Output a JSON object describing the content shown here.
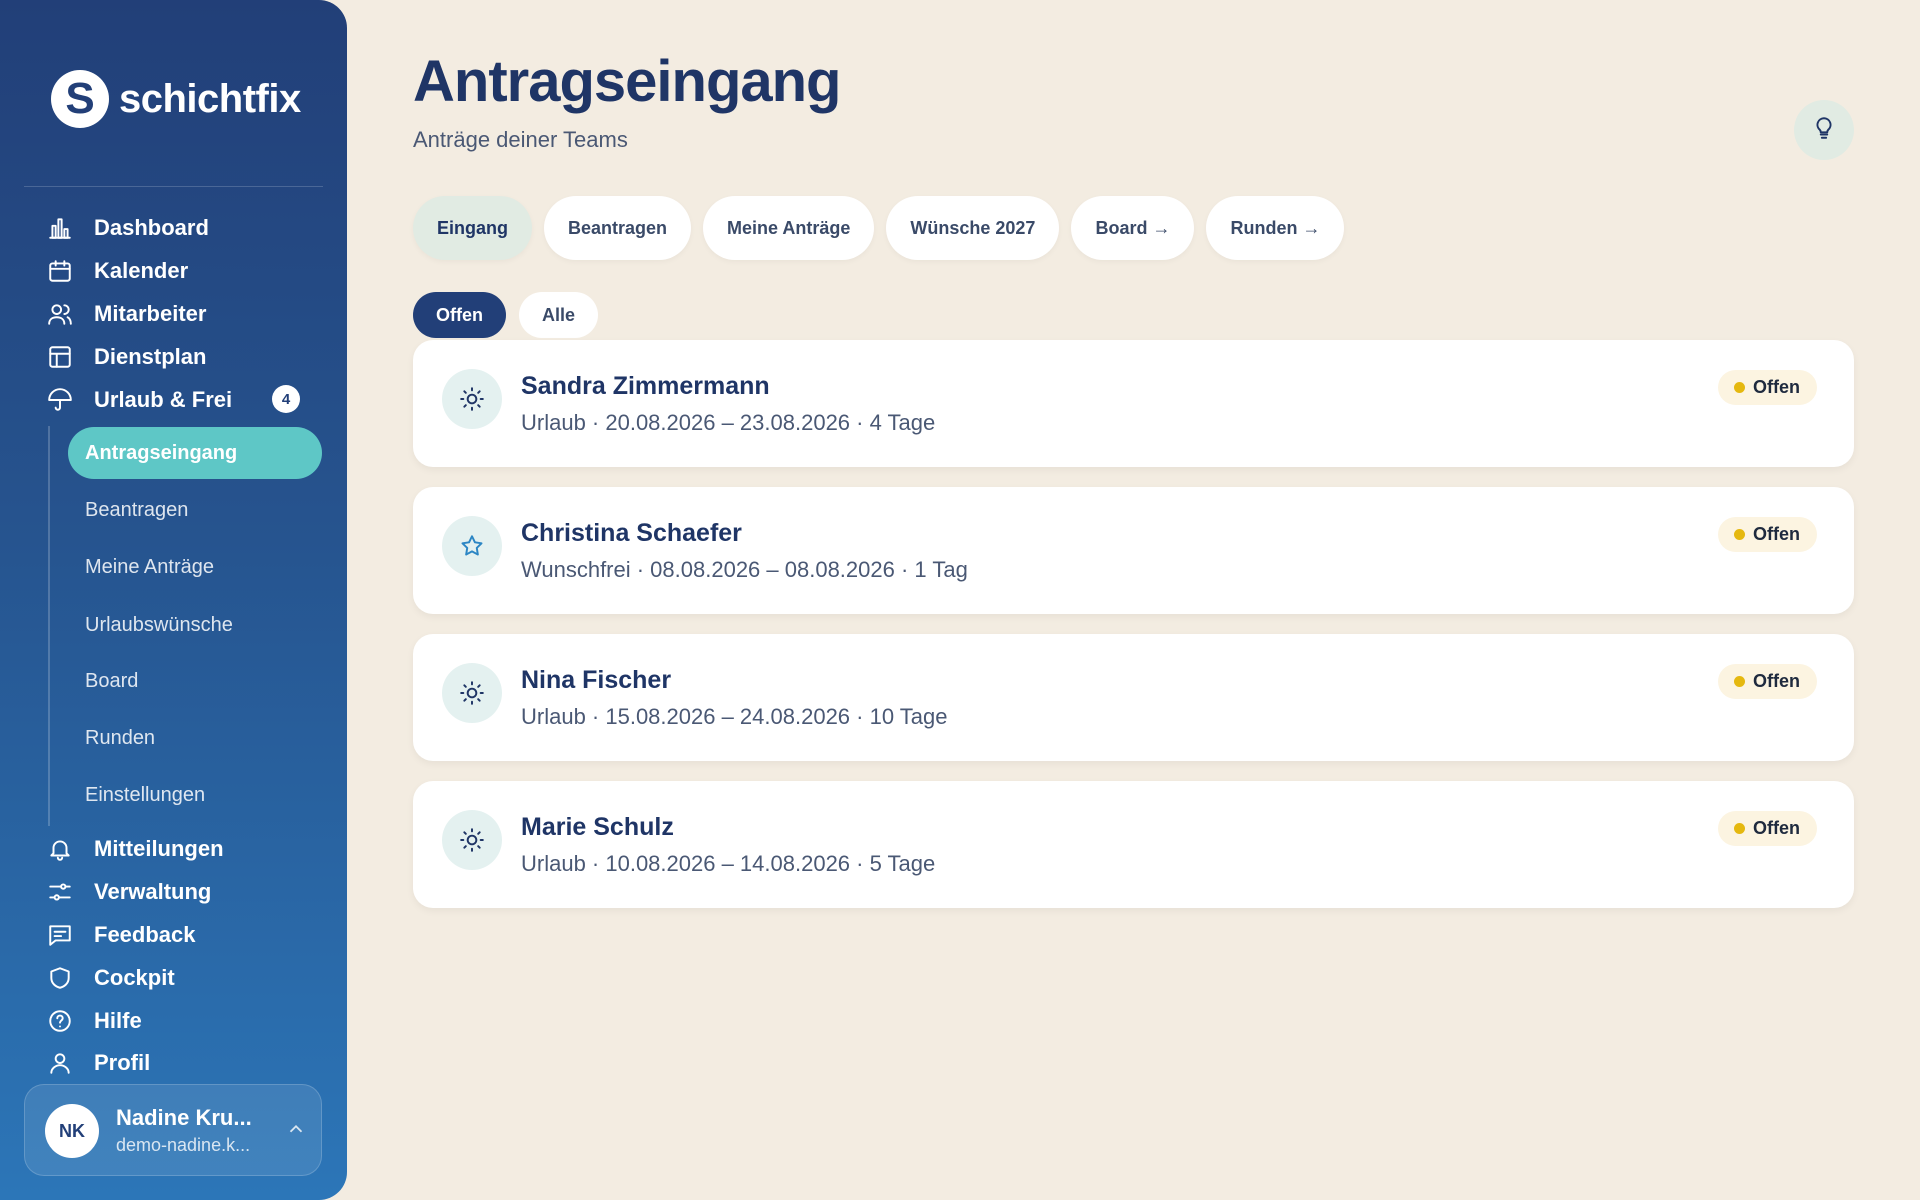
{
  "brand": {
    "name": "schichtfix",
    "mark": "S"
  },
  "sidebar": {
    "nav_top": [
      {
        "label": "Dashboard",
        "icon": "bar-chart-icon"
      },
      {
        "label": "Kalender",
        "icon": "calendar-icon"
      },
      {
        "label": "Mitarbeiter",
        "icon": "users-icon"
      },
      {
        "label": "Dienstplan",
        "icon": "layout-icon"
      },
      {
        "label": "Urlaub & Frei",
        "icon": "umbrella-icon",
        "badge": "4"
      }
    ],
    "sub_items": [
      {
        "label": "Antragseingang",
        "active": true
      },
      {
        "label": "Beantragen"
      },
      {
        "label": "Meine Anträge"
      },
      {
        "label": "Urlaubswünsche"
      },
      {
        "label": "Board"
      },
      {
        "label": "Runden"
      },
      {
        "label": "Einstellungen"
      }
    ],
    "nav_bottom": [
      {
        "label": "Mitteilungen",
        "icon": "bell-icon"
      },
      {
        "label": "Verwaltung",
        "icon": "sliders-icon"
      },
      {
        "label": "Feedback",
        "icon": "message-icon"
      },
      {
        "label": "Cockpit",
        "icon": "shield-icon"
      },
      {
        "label": "Hilfe",
        "icon": "help-circle-icon"
      },
      {
        "label": "Profil",
        "icon": "user-icon"
      }
    ],
    "user": {
      "initials": "NK",
      "name": "Nadine Kru...",
      "email": "demo-nadine.k..."
    }
  },
  "header": {
    "title": "Antragseingang",
    "subtitle": "Anträge deiner Teams"
  },
  "tabs": [
    {
      "label": "Eingang",
      "active": true
    },
    {
      "label": "Beantragen"
    },
    {
      "label": "Meine Anträge"
    },
    {
      "label": "Wünsche 2027"
    },
    {
      "label": "Board →"
    },
    {
      "label": "Runden →"
    }
  ],
  "filters": [
    {
      "label": "Offen",
      "active": true
    },
    {
      "label": "Alle"
    }
  ],
  "requests": [
    {
      "name": "Sandra Zimmermann",
      "detail": "Urlaub · 20.08.2026 – 23.08.2026 · 4 Tage",
      "status": "Offen",
      "icon": "sun-icon"
    },
    {
      "name": "Christina Schaefer",
      "detail": "Wunschfrei · 08.08.2026 – 08.08.2026 · 1 Tag",
      "status": "Offen",
      "icon": "star-icon"
    },
    {
      "name": "Nina Fischer",
      "detail": "Urlaub · 15.08.2026 – 24.08.2026 · 10 Tage",
      "status": "Offen",
      "icon": "sun-icon"
    },
    {
      "name": "Marie Schulz",
      "detail": "Urlaub · 10.08.2026 – 14.08.2026 · 5 Tage",
      "status": "Offen",
      "icon": "sun-icon"
    }
  ],
  "colors": {
    "background": "#f3ece1",
    "sidebar_top": "#223f78",
    "sidebar_bottom": "#2c76b8",
    "accent_teal": "#5ec7c6",
    "status_dot": "#e5b80f"
  }
}
